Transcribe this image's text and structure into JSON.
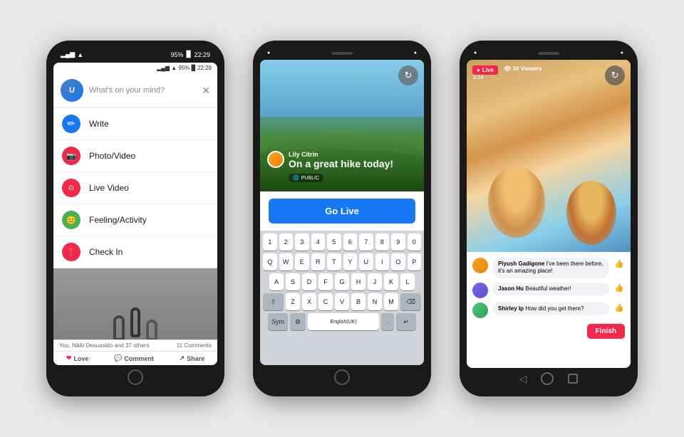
{
  "phone1": {
    "status": {
      "wifi": "wifi",
      "signal": "signal",
      "battery": "95%",
      "time": "22:29"
    },
    "compose": {
      "placeholder": "What's on your mind?"
    },
    "menu": [
      {
        "id": "write",
        "icon": "✏️",
        "label": "Write",
        "iconClass": "icon-write",
        "iconText": "✏"
      },
      {
        "id": "photo",
        "icon": "📷",
        "label": "Photo/Video",
        "iconClass": "icon-photo",
        "iconText": "📷"
      },
      {
        "id": "live",
        "icon": "📡",
        "label": "Live Video",
        "iconClass": "icon-live",
        "iconText": "⊙"
      },
      {
        "id": "feeling",
        "icon": "😊",
        "label": "Feeling/Activity",
        "iconClass": "icon-feeling",
        "iconText": "😊"
      },
      {
        "id": "checkin",
        "icon": "📍",
        "label": "Check In",
        "iconClass": "icon-checkin",
        "iconText": "📍"
      }
    ],
    "footer": {
      "likes": "You, Nikki Desuasido and 37 others",
      "comments": "11 Comments",
      "love": "Love",
      "comment": "Comment",
      "share": "Share"
    }
  },
  "phone2": {
    "user": {
      "name": "Lily Citrin"
    },
    "caption": "On a great hike today!",
    "public_label": "PUBLIC",
    "go_live": "Go Live",
    "keyboard": {
      "rows": [
        [
          "1",
          "2",
          "3",
          "4",
          "5",
          "6",
          "7",
          "8",
          "9",
          "0"
        ],
        [
          "Q",
          "W",
          "E",
          "R",
          "T",
          "Y",
          "U",
          "I",
          "O",
          "P"
        ],
        [
          "A",
          "S",
          "D",
          "F",
          "G",
          "H",
          "J",
          "K",
          "L"
        ],
        [
          "Z",
          "X",
          "C",
          "V",
          "B",
          "N",
          "M"
        ],
        [
          "Sym",
          "⚙",
          "English(UK)",
          ".",
          "↵"
        ]
      ]
    }
  },
  "phone3": {
    "live_label": "Live",
    "viewers": "34 Viewers",
    "timer": "3:34",
    "comments": [
      {
        "name": "Piyush Gadigone",
        "text": "I've been there before, it's an amazing place!",
        "liked": true
      },
      {
        "name": "Jason Hu",
        "text": "Beautiful weather!",
        "liked": false
      },
      {
        "name": "Shirley Ip",
        "text": "How did you get there?",
        "liked": false
      }
    ],
    "finish_label": "Finish"
  }
}
